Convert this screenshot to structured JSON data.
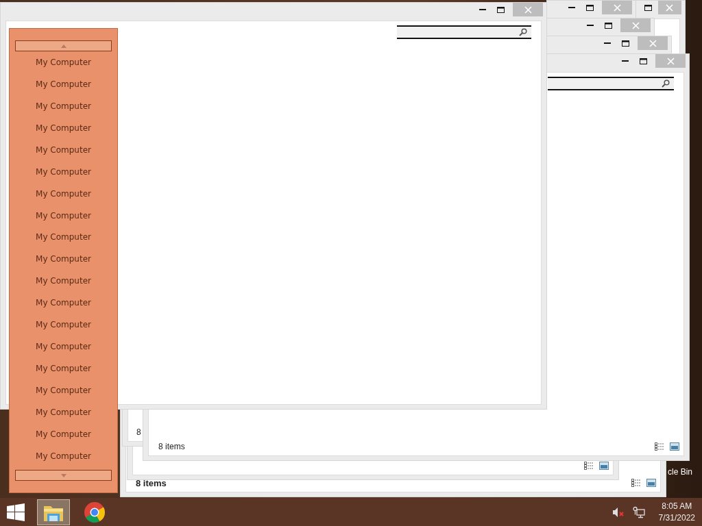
{
  "desktop": {
    "icon_label": "cle Bin"
  },
  "windows": [
    {
      "status": "8 items",
      "status_bold": true,
      "view_buttons": true
    },
    {
      "view_buttons": true
    },
    {
      "status": "8"
    },
    {
      "controls": [
        {
          "kind": "maximize"
        },
        {
          "kind": "close"
        }
      ]
    },
    {
      "controls": [
        {
          "kind": "minimize"
        },
        {
          "kind": "maximize"
        },
        {
          "kind": "close"
        }
      ]
    },
    {
      "controls": [
        {
          "kind": "minimize"
        },
        {
          "kind": "maximize"
        },
        {
          "kind": "close"
        }
      ]
    },
    {
      "controls": [
        {
          "kind": "minimize"
        },
        {
          "kind": "maximize"
        },
        {
          "kind": "close"
        }
      ]
    },
    {
      "controls": [
        {
          "kind": "minimize"
        },
        {
          "kind": "maximize"
        },
        {
          "kind": "close"
        }
      ],
      "search_field": true,
      "status": "8 items",
      "view_buttons": true
    },
    {
      "controls": [
        {
          "kind": "minimize"
        },
        {
          "kind": "maximize"
        },
        {
          "kind": "close"
        }
      ],
      "search_field": true
    }
  ],
  "menu": {
    "items": [
      "My Computer",
      "My Computer",
      "My Computer",
      "My Computer",
      "My Computer",
      "My Computer",
      "My Computer",
      "My Computer",
      "My Computer",
      "My Computer",
      "My Computer",
      "My Computer",
      "My Computer",
      "My Computer",
      "My Computer",
      "My Computer",
      "My Computer",
      "My Computer",
      "My Computer"
    ]
  },
  "taskbar": {
    "apps": [
      {
        "kind": "explorer",
        "selected": true
      },
      {
        "kind": "chrome",
        "selected": false
      }
    ],
    "tray": {
      "muted": true,
      "time": "8:05 AM",
      "date": "7/31/2022"
    }
  }
}
